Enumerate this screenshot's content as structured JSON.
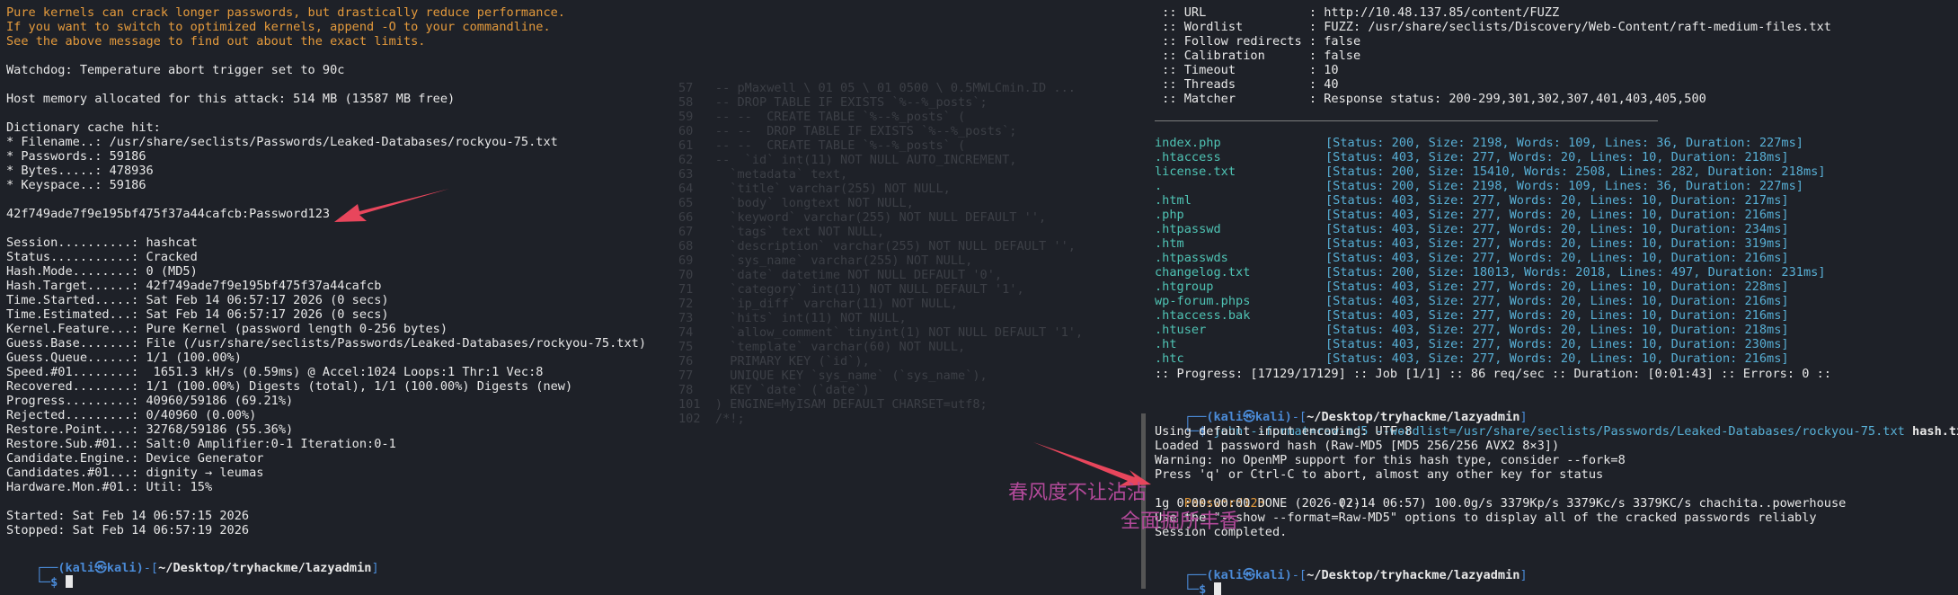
{
  "bg_code": {
    "lines": [
      "57   -- pMaxwell \\ 01 05 \\ 01 0500 \\ 0.5MWLCmin.ID ...",
      "58   -- DROP TABLE IF EXISTS `%--%_posts`;",
      "59   -- --  CREATE TABLE `%--%_posts` (",
      "60   -- --  DROP TABLE IF EXISTS `%--%_posts`;",
      "61   -- --  CREATE TABLE `%--%_posts` (",
      "62   --  `id` int(11) NOT NULL AUTO_INCREMENT,",
      "63     `metadata` text,",
      "64     `title` varchar(255) NOT NULL,",
      "65     `body` longtext NOT NULL,",
      "66     `keyword` varchar(255) NOT NULL DEFAULT '',",
      "67     `tags` text NOT NULL,",
      "68     `description` varchar(255) NOT NULL DEFAULT '',",
      "69     `sys_name` varchar(255) NOT NULL,",
      "70     `date` datetime NOT NULL DEFAULT '0',",
      "71     `category` int(11) NOT NULL DEFAULT '1',",
      "72     `ip_diff` varchar(11) NOT NULL,",
      "73     `hits` int(11) NOT NULL,",
      "74     `allow_comment` tinyint(1) NOT NULL DEFAULT '1',",
      "75     `template` varchar(60) NOT NULL,",
      "76     PRIMARY KEY (`id`),",
      "77     UNIQUE KEY `sys_name` (`sys_name`),",
      "78     KEY `date` (`date`)",
      "101  ) ENGINE=MyISAM DEFAULT CHARSET=utf8;",
      "102  /*!;"
    ]
  },
  "left": {
    "warnings": [
      "Pure kernels can crack longer passwords, but drastically reduce performance.",
      "If you want to switch to optimized kernels, append -O to your commandline.",
      "See the above message to find out about the exact limits."
    ],
    "body": [
      "",
      "Watchdog: Temperature abort trigger set to 90c",
      "",
      "Host memory allocated for this attack: 514 MB (13587 MB free)",
      "",
      "Dictionary cache hit:",
      "* Filename..: /usr/share/seclists/Passwords/Leaked-Databases/rockyou-75.txt",
      "* Passwords.: 59186",
      "* Bytes.....: 478936",
      "* Keyspace..: 59186",
      "",
      "42f749ade7f9e195bf475f37a44cafcb:Password123",
      "",
      "Session..........: hashcat",
      "Status...........: Cracked",
      "Hash.Mode........: 0 (MD5)",
      "Hash.Target......: 42f749ade7f9e195bf475f37a44cafcb",
      "Time.Started.....: Sat Feb 14 06:57:17 2026 (0 secs)",
      "Time.Estimated...: Sat Feb 14 06:57:17 2026 (0 secs)",
      "Kernel.Feature...: Pure Kernel (password length 0-256 bytes)",
      "Guess.Base.......: File (/usr/share/seclists/Passwords/Leaked-Databases/rockyou-75.txt)",
      "Guess.Queue......: 1/1 (100.00%)",
      "Speed.#01........:  1651.3 kH/s (0.59ms) @ Accel:1024 Loops:1 Thr:1 Vec:8",
      "Recovered........: 1/1 (100.00%) Digests (total), 1/1 (100.00%) Digests (new)",
      "Progress.........: 40960/59186 (69.21%)",
      "Rejected.........: 0/40960 (0.00%)",
      "Restore.Point....: 32768/59186 (55.36%)",
      "Restore.Sub.#01..: Salt:0 Amplifier:0-1 Iteration:0-1",
      "Candidate.Engine.: Device Generator",
      "Candidates.#01...: dignity → leumas",
      "Hardware.Mon.#01.: Util: 15%",
      "",
      "Started: Sat Feb 14 06:57:15 2026",
      "Stopped: Sat Feb 14 06:57:19 2026"
    ],
    "prompt": {
      "user": "(kali㉿kali)",
      "path": "~/Desktop/tryhackme/lazyadmin",
      "symbol": "$"
    }
  },
  "right": {
    "config": [
      " :: URL              : http://10.48.137.85/content/FUZZ",
      " :: Wordlist         : FUZZ: /usr/share/seclists/Discovery/Web-Content/raft-medium-files.txt",
      " :: Follow redirects : false",
      " :: Calibration      : false",
      " :: Timeout          : 10",
      " :: Threads          : 40",
      " :: Matcher          : Response status: 200-299,301,302,307,401,403,405,500"
    ],
    "results": [
      {
        "name": "index.php",
        "info": "[Status: 200, Size: 2198, Words: 109, Lines: 36, Duration: 227ms]"
      },
      {
        "name": ".htaccess",
        "info": "[Status: 403, Size: 277, Words: 20, Lines: 10, Duration: 218ms]"
      },
      {
        "name": "license.txt",
        "info": "[Status: 200, Size: 15410, Words: 2508, Lines: 282, Duration: 218ms]"
      },
      {
        "name": ".",
        "info": "[Status: 200, Size: 2198, Words: 109, Lines: 36, Duration: 227ms]"
      },
      {
        "name": ".html",
        "info": "[Status: 403, Size: 277, Words: 20, Lines: 10, Duration: 217ms]"
      },
      {
        "name": ".php",
        "info": "[Status: 403, Size: 277, Words: 20, Lines: 10, Duration: 216ms]"
      },
      {
        "name": ".htpasswd",
        "info": "[Status: 403, Size: 277, Words: 20, Lines: 10, Duration: 234ms]"
      },
      {
        "name": ".htm",
        "info": "[Status: 403, Size: 277, Words: 20, Lines: 10, Duration: 319ms]"
      },
      {
        "name": ".htpasswds",
        "info": "[Status: 403, Size: 277, Words: 20, Lines: 10, Duration: 216ms]"
      },
      {
        "name": "changelog.txt",
        "info": "[Status: 200, Size: 18013, Words: 2018, Lines: 497, Duration: 231ms]"
      },
      {
        "name": ".htgroup",
        "info": "[Status: 403, Size: 277, Words: 20, Lines: 10, Duration: 228ms]"
      },
      {
        "name": "wp-forum.phps",
        "info": "[Status: 403, Size: 277, Words: 20, Lines: 10, Duration: 216ms]"
      },
      {
        "name": ".htaccess.bak",
        "info": "[Status: 403, Size: 277, Words: 20, Lines: 10, Duration: 216ms]"
      },
      {
        "name": ".htuser",
        "info": "[Status: 403, Size: 277, Words: 20, Lines: 10, Duration: 218ms]"
      },
      {
        "name": ".ht",
        "info": "[Status: 403, Size: 277, Words: 20, Lines: 10, Duration: 230ms]"
      },
      {
        "name": ".htc",
        "info": "[Status: 403, Size: 277, Words: 20, Lines: 10, Duration: 216ms]"
      }
    ],
    "progress": ":: Progress: [17129/17129] :: Job [1/1] :: 86 req/sec :: Duration: [0:01:43] :: Errors: 0 ::",
    "prompt1": {
      "user": "(kali㉿kali)",
      "path": "~/Desktop/tryhackme/lazyadmin",
      "symbol": "$"
    },
    "john_cmd": {
      "program": "john",
      "args": " --format=raw-md5 --wordlist=/usr/share/seclists/Passwords/Leaked-Databases/rockyou-75.txt ",
      "file": "hash.txt"
    },
    "john_output": [
      "Using default input encoding: UTF-8",
      "Loaded 1 password hash (Raw-MD5 [MD5 256/256 AVX2 8×3])",
      "Warning: no OpenMP support for this hash type, consider --fork=8",
      "Press 'q' or Ctrl-C to abort, almost any other key for status"
    ],
    "cracked_password": "Password123",
    "cracked_suffix": "          (?)",
    "john_output2": [
      "1g 0:00:00:00 DONE (2026-02-14 06:57) 100.0g/s 3379Kp/s 3379Kc/s 3379KC/s chachita..powerhouse",
      "Use the \"--show --format=Raw-MD5\" options to display all of the cracked passwords reliably",
      "Session completed."
    ],
    "prompt2": {
      "user": "(kali㉿kali)",
      "path": "~/Desktop/tryhackme/lazyadmin",
      "symbol": "$"
    }
  },
  "watermark": {
    "line1": "春风度不让沾沾",
    "line2": "全面掘所丰香"
  },
  "colors": {
    "background": "#1e2128",
    "warning": "#e49a3c",
    "filename": "#4fc3b4",
    "status": "#58b0d6",
    "prompt": "#4a8ad6",
    "arrow": "#e8465c",
    "watermark": "#b34a9a"
  }
}
